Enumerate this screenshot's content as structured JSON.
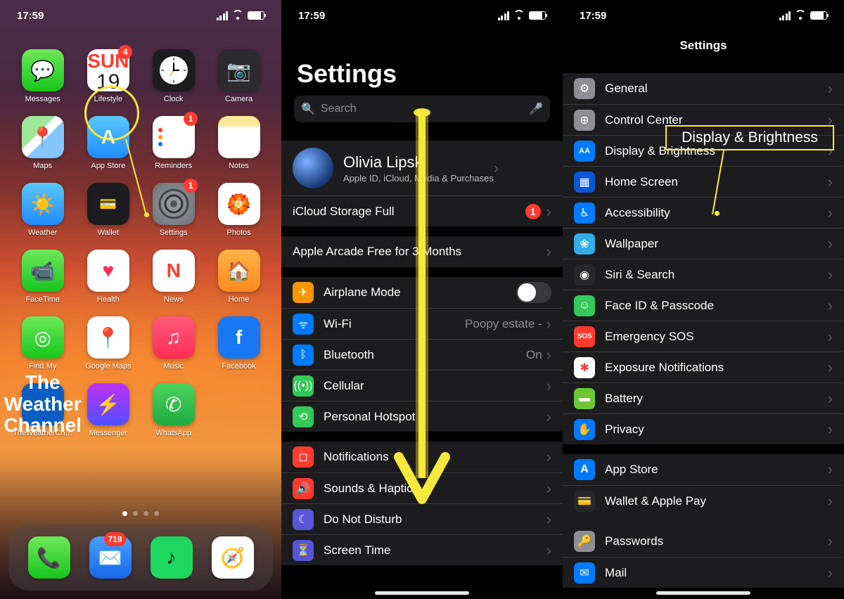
{
  "status": {
    "time": "17:59"
  },
  "home": {
    "apps": [
      {
        "name": "messages",
        "label": "Messages"
      },
      {
        "name": "calendar",
        "label": "Lifestyle",
        "badge": "4",
        "day": "SUN",
        "date": "19"
      },
      {
        "name": "clock",
        "label": "Clock"
      },
      {
        "name": "camera",
        "label": "Camera"
      },
      {
        "name": "maps",
        "label": "Maps"
      },
      {
        "name": "app-store",
        "label": "App Store"
      },
      {
        "name": "reminders",
        "label": "Reminders",
        "badge": "1"
      },
      {
        "name": "notes",
        "label": "Notes"
      },
      {
        "name": "weather",
        "label": "Weather"
      },
      {
        "name": "wallet",
        "label": "Wallet"
      },
      {
        "name": "settings",
        "label": "Settings",
        "badge": "1"
      },
      {
        "name": "photos",
        "label": "Photos"
      },
      {
        "name": "facetime",
        "label": "FaceTime"
      },
      {
        "name": "health",
        "label": "Health"
      },
      {
        "name": "news",
        "label": "News"
      },
      {
        "name": "home-app",
        "label": "Home"
      },
      {
        "name": "find-my",
        "label": "Find My"
      },
      {
        "name": "google-maps",
        "label": "Google Maps"
      },
      {
        "name": "music",
        "label": "Music"
      },
      {
        "name": "facebook",
        "label": "Facebook"
      },
      {
        "name": "weather-channel",
        "label": "TheWeatherCh…"
      },
      {
        "name": "messenger",
        "label": "Messenger"
      },
      {
        "name": "whatsapp",
        "label": "WhatsApp"
      }
    ],
    "dock": [
      {
        "name": "phone",
        "label": "Phone"
      },
      {
        "name": "mail",
        "label": "Mail",
        "badge": "719"
      },
      {
        "name": "spotify",
        "label": "Spotify"
      },
      {
        "name": "safari",
        "label": "Safari"
      }
    ]
  },
  "settings2": {
    "title": "Settings",
    "search_placeholder": "Search",
    "profile": {
      "name": "Olivia Lipski",
      "sub": "Apple ID, iCloud, Media & Purchases"
    },
    "storage": {
      "label": "iCloud Storage Full",
      "badge": "1"
    },
    "arcade": "Apple Arcade Free for 3 Months",
    "rows1": [
      {
        "key": "airplane",
        "label": "Airplane Mode",
        "value": "",
        "toggle": true
      },
      {
        "key": "wifi",
        "label": "Wi-Fi",
        "value": "Poopy estate -"
      },
      {
        "key": "bluetooth",
        "label": "Bluetooth",
        "value": "On"
      },
      {
        "key": "cellular",
        "label": "Cellular",
        "value": ""
      },
      {
        "key": "hotspot",
        "label": "Personal Hotspot",
        "value": ""
      }
    ],
    "rows2": [
      {
        "key": "notifications",
        "label": "Notifications"
      },
      {
        "key": "sounds",
        "label": "Sounds & Haptics"
      },
      {
        "key": "dnd",
        "label": "Do Not Disturb"
      },
      {
        "key": "screentime",
        "label": "Screen Time"
      }
    ]
  },
  "settings3": {
    "title": "Settings",
    "highlight": "Display & Brightness",
    "rowsA": [
      {
        "key": "general",
        "label": "General"
      },
      {
        "key": "control-center",
        "label": "Control Center"
      },
      {
        "key": "display",
        "label": "Display & Brightness"
      },
      {
        "key": "home-screen",
        "label": "Home Screen"
      },
      {
        "key": "accessibility",
        "label": "Accessibility"
      },
      {
        "key": "wallpaper",
        "label": "Wallpaper"
      },
      {
        "key": "siri",
        "label": "Siri & Search"
      },
      {
        "key": "faceid",
        "label": "Face ID & Passcode"
      },
      {
        "key": "sos",
        "label": "Emergency SOS"
      },
      {
        "key": "exposure",
        "label": "Exposure Notifications"
      },
      {
        "key": "battery",
        "label": "Battery"
      },
      {
        "key": "privacy",
        "label": "Privacy"
      }
    ],
    "rowsB": [
      {
        "key": "app-store",
        "label": "App Store"
      },
      {
        "key": "wallet-pay",
        "label": "Wallet & Apple Pay"
      }
    ],
    "rowsC": [
      {
        "key": "passwords",
        "label": "Passwords"
      },
      {
        "key": "mail",
        "label": "Mail"
      }
    ]
  }
}
